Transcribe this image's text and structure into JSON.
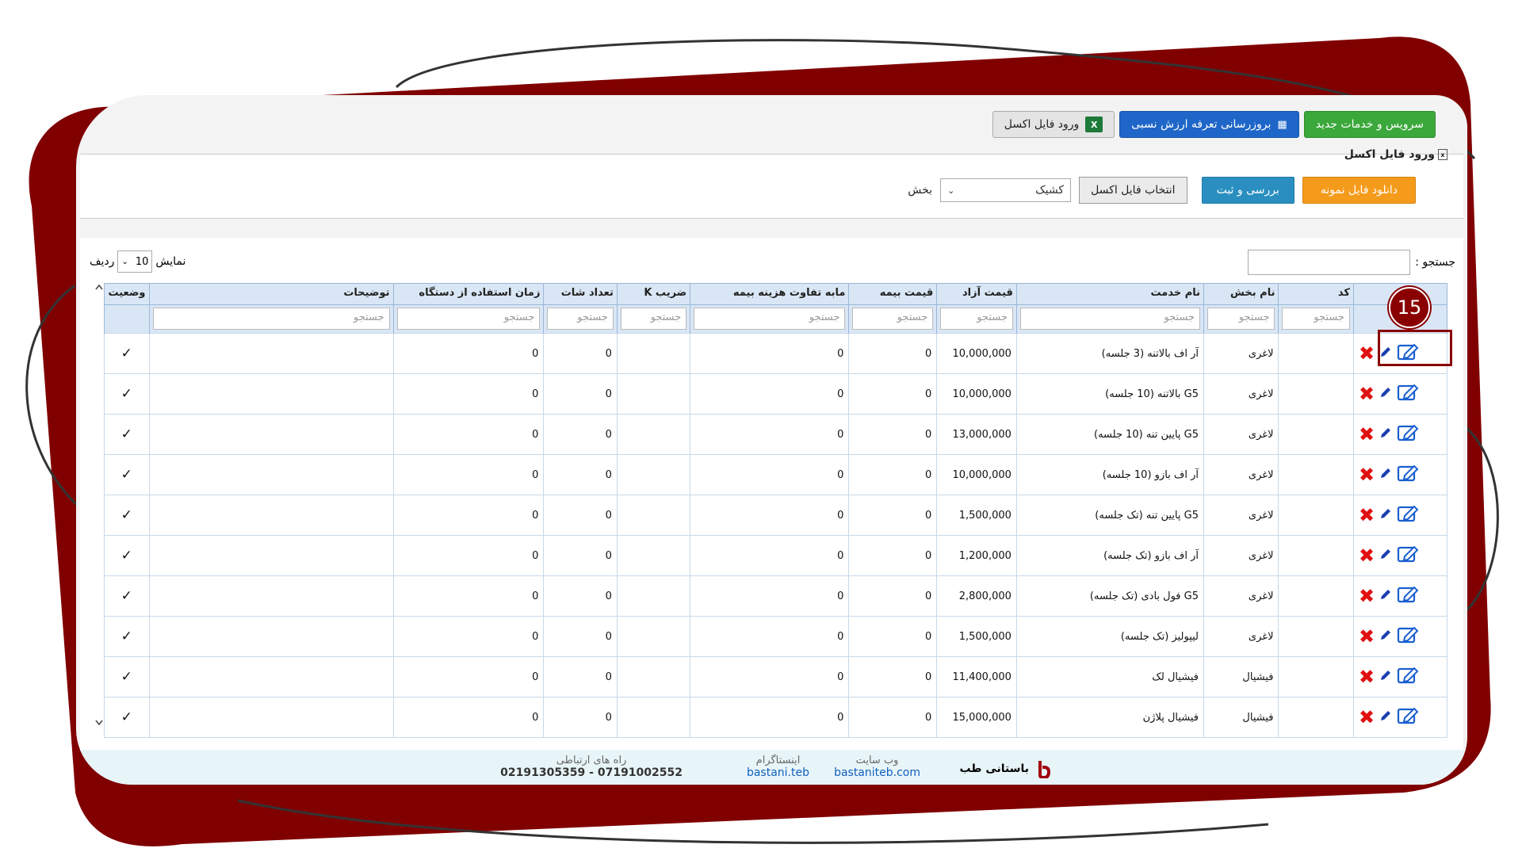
{
  "toolbar": {
    "new_services_label": "سرویس و خدمات جدید",
    "update_tariff_label": "بروزرسانی تعرفه ارزش نسبی",
    "excel_import_label": "ورود فایل اکسل"
  },
  "import_panel": {
    "title": "ورود فایل اکسل",
    "section_label": "بخش",
    "section_value": "کشیک",
    "choose_file_label": "انتخاب فایل اکسل",
    "review_label": "بررسی و ثبت",
    "download_sample_label": "دانلود فایل نمونه"
  },
  "table_controls": {
    "search_label": "جستجو :",
    "show_label": "نمایش",
    "page_length": "10",
    "rows_label": "ردیف"
  },
  "table": {
    "columns": [
      "",
      "کد",
      "نام بخش",
      "نام خدمت",
      "قیمت آزاد",
      "قیمت بیمه",
      "مابه تفاوت هزینه بیمه",
      "ضریب K",
      "تعداد شات",
      "زمان استفاده از دستگاه",
      "توضیحات",
      "وضعیت"
    ],
    "filter_placeholder": "جستجو",
    "rows": [
      {
        "department": "لاغری",
        "service": "آر اف بالاتنه (3 جلسه)",
        "free_price": "10,000,000",
        "insurance_price": "0",
        "diff": "0",
        "shots": "0",
        "usage": "0",
        "status": "✓"
      },
      {
        "department": "لاغری",
        "service": "G5 بالاتنه (10 جلسه)",
        "free_price": "10,000,000",
        "insurance_price": "0",
        "diff": "0",
        "shots": "0",
        "usage": "0",
        "status": "✓"
      },
      {
        "department": "لاغری",
        "service": "G5 پایین تنه (10 جلسه)",
        "free_price": "13,000,000",
        "insurance_price": "0",
        "diff": "0",
        "shots": "0",
        "usage": "0",
        "status": "✓"
      },
      {
        "department": "لاغری",
        "service": "آر اف بازو (10 جلسه)",
        "free_price": "10,000,000",
        "insurance_price": "0",
        "diff": "0",
        "shots": "0",
        "usage": "0",
        "status": "✓"
      },
      {
        "department": "لاغری",
        "service": "G5 پایین تنه (تک جلسه)",
        "free_price": "1,500,000",
        "insurance_price": "0",
        "diff": "0",
        "shots": "0",
        "usage": "0",
        "status": "✓"
      },
      {
        "department": "لاغری",
        "service": "آر اف بازو (تک جلسه)",
        "free_price": "1,200,000",
        "insurance_price": "0",
        "diff": "0",
        "shots": "0",
        "usage": "0",
        "status": "✓"
      },
      {
        "department": "لاغری",
        "service": "G5 فول بادی (تک جلسه)",
        "free_price": "2,800,000",
        "insurance_price": "0",
        "diff": "0",
        "shots": "0",
        "usage": "0",
        "status": "✓"
      },
      {
        "department": "لاغری",
        "service": "لیپولیز (تک جلسه)",
        "free_price": "1,500,000",
        "insurance_price": "0",
        "diff": "0",
        "shots": "0",
        "usage": "0",
        "status": "✓"
      },
      {
        "department": "فیشیال",
        "service": "فیشیال لک",
        "free_price": "11,400,000",
        "insurance_price": "0",
        "diff": "0",
        "shots": "0",
        "usage": "0",
        "status": "✓"
      },
      {
        "department": "فیشیال",
        "service": "فیشیال پلاژن",
        "free_price": "15,000,000",
        "insurance_price": "0",
        "diff": "0",
        "shots": "0",
        "usage": "0",
        "status": "✓"
      }
    ]
  },
  "annotation": {
    "step_number": "15"
  },
  "footer": {
    "brand": "باستانی طب",
    "website_label": "وب سایت",
    "website_value": "bastaniteb.com",
    "instagram_label": "اینستاگرام",
    "instagram_value": "bastani.teb",
    "contact_label": "راه های ارتباطی",
    "contact_value": "07191002552 - 02191305359"
  },
  "colors": {
    "frame": "#8a0000",
    "accent_blue": "#1e66c8",
    "accent_green": "#3aa83a",
    "accent_orange": "#f59b1c",
    "delete_red": "#e01010"
  }
}
